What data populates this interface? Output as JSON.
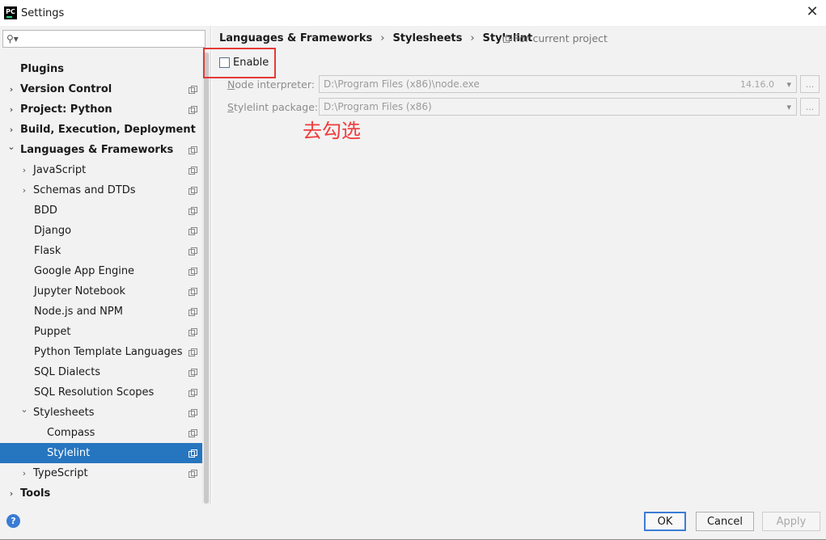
{
  "window": {
    "title": "Settings",
    "app_icon_text": "PC",
    "close_glyph": "✕"
  },
  "search": {
    "icon": "search-icon",
    "value": ""
  },
  "sidebar": {
    "items": [
      {
        "label": "Plugins",
        "level": 0,
        "bold": true,
        "chevron": "",
        "copy": false
      },
      {
        "label": "Version Control",
        "level": 0,
        "bold": true,
        "chevron": "›",
        "copy": true
      },
      {
        "label": "Project: Python",
        "level": 0,
        "bold": true,
        "chevron": "›",
        "copy": true
      },
      {
        "label": "Build, Execution, Deployment",
        "level": 0,
        "bold": true,
        "chevron": "›",
        "copy": false
      },
      {
        "label": "Languages & Frameworks",
        "level": 0,
        "bold": true,
        "chevron": "⌄",
        "copy": true
      },
      {
        "label": "JavaScript",
        "level": 1,
        "bold": false,
        "chevron": "›",
        "copy": true
      },
      {
        "label": "Schemas and DTDs",
        "level": 1,
        "bold": false,
        "chevron": "›",
        "copy": true
      },
      {
        "label": "BDD",
        "level": 1,
        "bold": false,
        "chevron": "",
        "copy": true
      },
      {
        "label": "Django",
        "level": 1,
        "bold": false,
        "chevron": "",
        "copy": true
      },
      {
        "label": "Flask",
        "level": 1,
        "bold": false,
        "chevron": "",
        "copy": true
      },
      {
        "label": "Google App Engine",
        "level": 1,
        "bold": false,
        "chevron": "",
        "copy": true
      },
      {
        "label": "Jupyter Notebook",
        "level": 1,
        "bold": false,
        "chevron": "",
        "copy": true
      },
      {
        "label": "Node.js and NPM",
        "level": 1,
        "bold": false,
        "chevron": "",
        "copy": true
      },
      {
        "label": "Puppet",
        "level": 1,
        "bold": false,
        "chevron": "",
        "copy": true
      },
      {
        "label": "Python Template Languages",
        "level": 1,
        "bold": false,
        "chevron": "",
        "copy": true
      },
      {
        "label": "SQL Dialects",
        "level": 1,
        "bold": false,
        "chevron": "",
        "copy": true
      },
      {
        "label": "SQL Resolution Scopes",
        "level": 1,
        "bold": false,
        "chevron": "",
        "copy": true
      },
      {
        "label": "Stylesheets",
        "level": 1,
        "bold": false,
        "chevron": "⌄",
        "copy": true
      },
      {
        "label": "Compass",
        "level": 2,
        "bold": false,
        "chevron": "",
        "copy": true
      },
      {
        "label": "Stylelint",
        "level": 2,
        "bold": false,
        "chevron": "",
        "copy": true,
        "selected": true
      },
      {
        "label": "TypeScript",
        "level": 1,
        "bold": false,
        "chevron": "›",
        "copy": true
      },
      {
        "label": "Tools",
        "level": 0,
        "bold": true,
        "chevron": "›",
        "copy": false
      }
    ]
  },
  "breadcrumb": {
    "items": [
      "Languages & Frameworks",
      "Stylesheets",
      "Stylelint"
    ],
    "separator": "›",
    "scope_label": "For current project"
  },
  "enable": {
    "label": "Enable",
    "checked": false
  },
  "fields": {
    "node_interpreter": {
      "label_underlined": "N",
      "label_rest": "ode interpreter:",
      "value": "D:\\Program Files (x86)\\node.exe",
      "version": "14.16.0",
      "dots": "..."
    },
    "stylelint_package": {
      "label_underlined": "S",
      "label_rest": "tylelint package:",
      "value": "D:\\Program Files (x86)",
      "dots": "..."
    }
  },
  "annotation": {
    "text": "去勾选",
    "color": "#f03c3c"
  },
  "footer": {
    "help_glyph": "?",
    "ok": "OK",
    "cancel": "Cancel",
    "apply": "Apply"
  },
  "colors": {
    "selection": "#2675bf",
    "annotation_box": "#e53935",
    "panel_bg": "#f2f2f2"
  }
}
